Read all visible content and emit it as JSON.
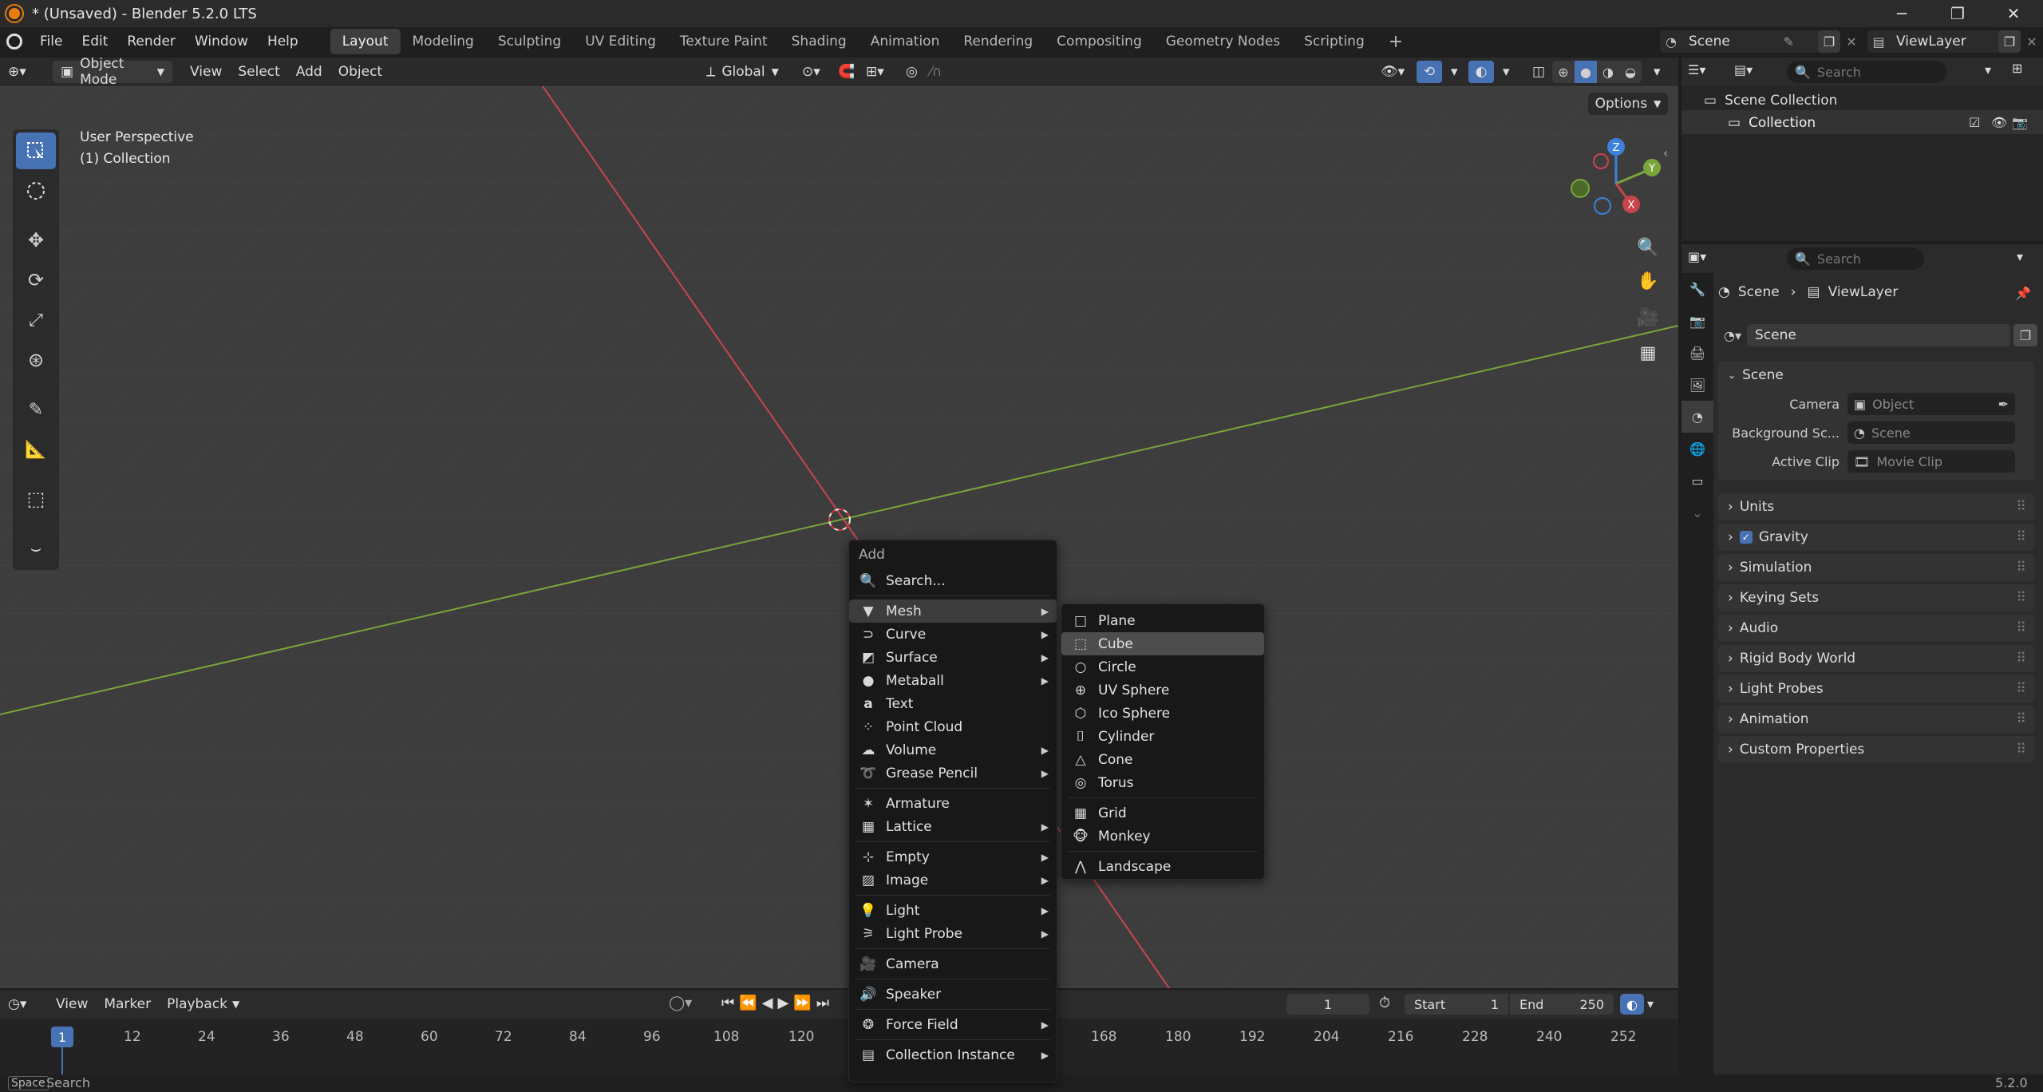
{
  "window": {
    "title": "* (Unsaved) - Blender 5.2.0 LTS",
    "min": "─",
    "max": "❐",
    "close": "✕"
  },
  "menubar": {
    "items": [
      "File",
      "Edit",
      "Render",
      "Window",
      "Help"
    ]
  },
  "workspaces": [
    "Layout",
    "Modeling",
    "Sculpting",
    "UV Editing",
    "Texture Paint",
    "Shading",
    "Animation",
    "Rendering",
    "Compositing",
    "Geometry Nodes",
    "Scripting"
  ],
  "workspace_add": "+",
  "scene_selector": "Scene",
  "viewlayer_selector": "ViewLayer",
  "viewport_header": {
    "mode": "Object Mode",
    "menus": [
      "View",
      "Select",
      "Add",
      "Object"
    ],
    "orientation": "Global",
    "options": "Options"
  },
  "viewport": {
    "perspective": "User Perspective",
    "collection": "(1) Collection",
    "gizmo": {
      "z": "Z",
      "y": "Y",
      "x": "X"
    }
  },
  "add_menu": {
    "title": "Add",
    "search": "Search...",
    "items": [
      {
        "label": "Mesh",
        "icon": "mesh-icon",
        "submenu": true
      },
      {
        "label": "Curve",
        "icon": "curve-icon",
        "submenu": true
      },
      {
        "label": "Surface",
        "icon": "surface-icon",
        "submenu": true
      },
      {
        "label": "Metaball",
        "icon": "metaball-icon",
        "submenu": true
      },
      {
        "label": "Text",
        "icon": "text-icon",
        "submenu": false
      },
      {
        "label": "Point Cloud",
        "icon": "point-cloud-icon",
        "submenu": false
      },
      {
        "label": "Volume",
        "icon": "volume-icon",
        "submenu": true
      },
      {
        "label": "Grease Pencil",
        "icon": "grease-pencil-icon",
        "submenu": true
      },
      {
        "label": "Armature",
        "icon": "armature-icon",
        "submenu": false
      },
      {
        "label": "Lattice",
        "icon": "lattice-icon",
        "submenu": true
      },
      {
        "label": "Empty",
        "icon": "empty-icon",
        "submenu": true
      },
      {
        "label": "Image",
        "icon": "image-icon",
        "submenu": true
      },
      {
        "label": "Light",
        "icon": "light-icon",
        "submenu": true
      },
      {
        "label": "Light Probe",
        "icon": "light-probe-icon",
        "submenu": true
      },
      {
        "label": "Camera",
        "icon": "camera-icon",
        "submenu": false
      },
      {
        "label": "Speaker",
        "icon": "speaker-icon",
        "submenu": false
      },
      {
        "label": "Force Field",
        "icon": "force-field-icon",
        "submenu": true
      },
      {
        "label": "Collection Instance",
        "icon": "collection-instance-icon",
        "submenu": true
      }
    ]
  },
  "mesh_submenu": {
    "items": [
      "Plane",
      "Cube",
      "Circle",
      "UV Sphere",
      "Ico Sphere",
      "Cylinder",
      "Cone",
      "Torus",
      "Grid",
      "Monkey",
      "Landscape"
    ],
    "selected": "Cube"
  },
  "timeline": {
    "menus": [
      "View",
      "Marker",
      "Playback"
    ],
    "current_frame": "1",
    "start_label": "Start",
    "start": "1",
    "end_label": "End",
    "end": "250",
    "ruler": [
      "1",
      "12",
      "24",
      "36",
      "48",
      "60",
      "72",
      "84",
      "96",
      "108",
      "120",
      "168",
      "180",
      "192",
      "204",
      "216",
      "228",
      "240",
      "252"
    ]
  },
  "statusbar": {
    "key": "Space",
    "action": "Search",
    "version": "5.2.0"
  },
  "outliner": {
    "search_placeholder": "Search",
    "scene_collection": "Scene Collection",
    "collection": "Collection"
  },
  "properties": {
    "search_placeholder": "Search",
    "breadcrumb": [
      "Scene",
      "ViewLayer"
    ],
    "scene_name": "Scene",
    "scene_panel": "Scene",
    "camera_label": "Camera",
    "camera_value": "Object",
    "background_label": "Background Sc...",
    "background_value": "Scene",
    "clip_label": "Active Clip",
    "clip_value": "Movie Clip",
    "panels": [
      "Units",
      "Gravity",
      "Simulation",
      "Keying Sets",
      "Audio",
      "Rigid Body World",
      "Light Probes",
      "Animation",
      "Custom Properties"
    ]
  },
  "colors": {
    "accent": "#4772b3",
    "x_axis": "#c8464b",
    "y_axis": "#7aa53c",
    "z_axis": "#3c82dc",
    "bg": "#3d3d3d"
  }
}
